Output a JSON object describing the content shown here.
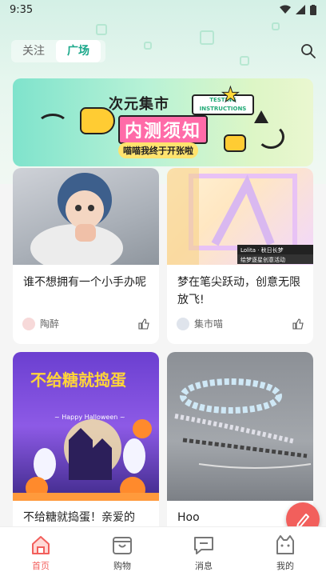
{
  "status": {
    "time": "9:35"
  },
  "header": {
    "tabs": [
      {
        "label": "关注",
        "active": false
      },
      {
        "label": "广场",
        "active": true
      }
    ]
  },
  "banner": {
    "title": "次元集市",
    "tag": "TESTING INSTRUCTIONS",
    "headline": "内测须知",
    "subtitle": "喵喵我终于开张啦"
  },
  "posts": [
    {
      "title": "谁不想拥有一个小手办呢",
      "author": "陶醉"
    },
    {
      "title": "梦在笔尖跃动，创意无限放飞!",
      "author": "集市喵",
      "image_caption": "Lolita · 秋日长梦",
      "image_caption2": "绘梦逐星创意活动"
    },
    {
      "title": "不给糖就捣蛋！亲爱的",
      "author": "",
      "image_text": "不给糖就捣蛋",
      "image_text2": "~ Happy Halloween ~"
    },
    {
      "title": "Hoo",
      "author": ""
    }
  ],
  "nav": [
    {
      "label": "首页",
      "icon": "home-icon",
      "active": true
    },
    {
      "label": "购物",
      "icon": "shop-icon",
      "active": false
    },
    {
      "label": "消息",
      "icon": "message-icon",
      "active": false
    },
    {
      "label": "我的",
      "icon": "profile-icon",
      "active": false
    }
  ],
  "colors": {
    "accent": "#1aa88a",
    "nav_active": "#f25f5c"
  }
}
